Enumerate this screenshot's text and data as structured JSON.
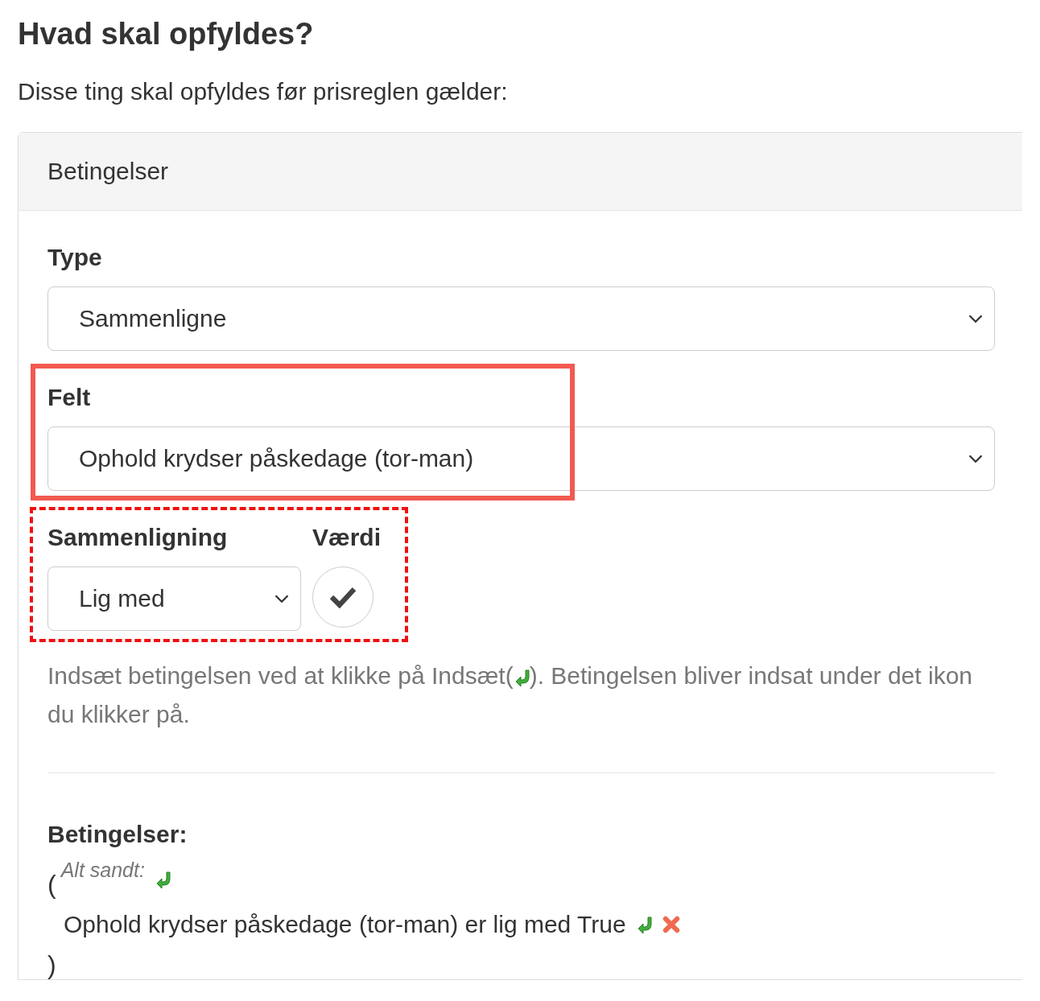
{
  "title": "Hvad skal opfyldes?",
  "intro": "Disse ting skal opfyldes før prisreglen gælder:",
  "card": {
    "header": "Betingelser",
    "type_field": {
      "label": "Type",
      "value": "Sammenligne"
    },
    "field_field": {
      "label": "Felt",
      "value": "Ophold krydser påskedage (tor-man)",
      "highlighted": true,
      "dashed": false
    },
    "compare": {
      "highlighted": true,
      "dashed": true,
      "comparison_label": "Sammenligning",
      "comparison_value": "Lig med",
      "value_label": "Værdi",
      "checked": true
    },
    "help": {
      "before": "Indsæt betingelsen ved at klikke på Indsæt(",
      "after": "). Betingelsen bliver indsat under det ikon du klikker på."
    },
    "conditions": {
      "heading": "Betingelser:",
      "open": "(",
      "group_label": "Alt sandt:",
      "items": [
        {
          "text": "Ophold krydser påskedage (tor-man) er lig med True"
        }
      ],
      "close": ")"
    }
  }
}
